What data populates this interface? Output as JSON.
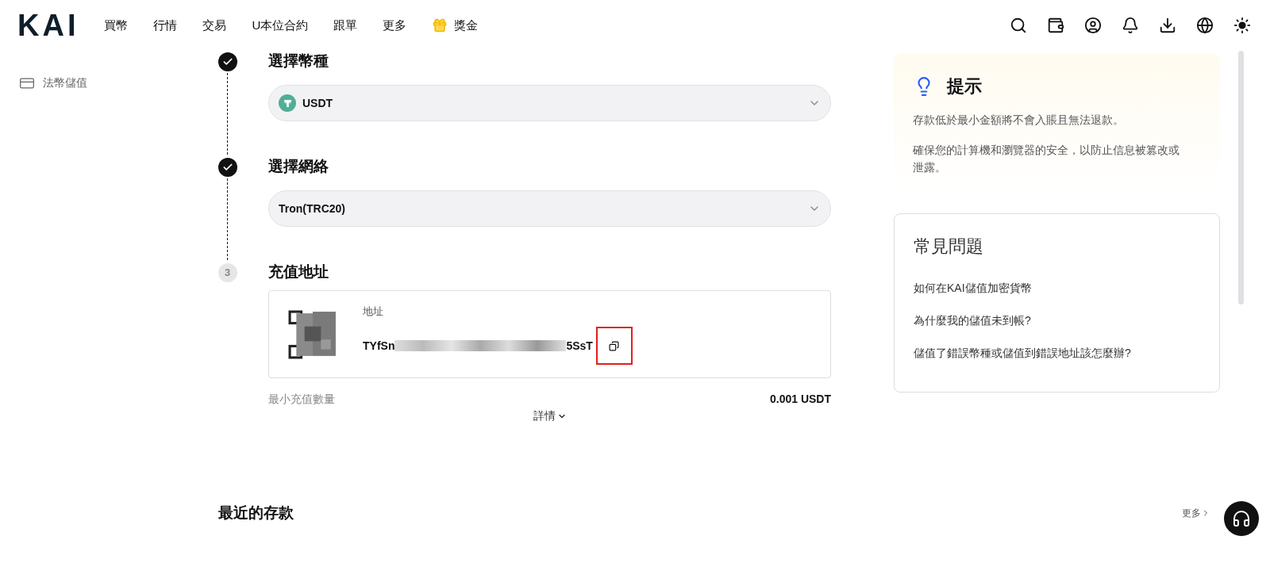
{
  "header": {
    "logo": "KAI",
    "nav": [
      {
        "label": "買幣",
        "kind": "text"
      },
      {
        "label": "行情",
        "kind": "text"
      },
      {
        "label": "交易",
        "kind": "text"
      },
      {
        "label": "U本位合約",
        "kind": "text"
      },
      {
        "label": "跟單",
        "kind": "text"
      },
      {
        "label": "更多",
        "kind": "text"
      },
      {
        "label": "獎金",
        "kind": "gift"
      }
    ]
  },
  "sidebar": {
    "items": [
      {
        "label": "法幣儲值"
      }
    ]
  },
  "steps": [
    {
      "kind": "done",
      "title": "選擇幣種",
      "select": {
        "value": "USDT",
        "kind": "coin"
      }
    },
    {
      "kind": "done",
      "title": "選擇網絡",
      "select": {
        "value": "Tron(TRC20)",
        "kind": "plain"
      }
    },
    {
      "kind": "current",
      "number": "3",
      "title": "充值地址"
    }
  ],
  "address": {
    "label": "地址",
    "start": "TYfSn",
    "end": "5SsT",
    "copy_highlighted": true
  },
  "min_deposit": {
    "label": "最小充值數量",
    "value": "0.001 USDT"
  },
  "details_link": "詳情",
  "recent": {
    "title": "最近的存款",
    "more": "更多"
  },
  "tips": {
    "title": "提示",
    "paragraphs": [
      "存款低於最小金額將不會入賬且無法退款。",
      "確保您的計算機和瀏覽器的安全，以防止信息被篡改或泄露。"
    ]
  },
  "faq": {
    "title": "常見問題",
    "items": [
      "如何在KAI儲值加密貨幣",
      "為什麼我的儲值未到帳?",
      "儲值了錯誤幣種或儲值到錯誤地址該怎麼辦?"
    ]
  }
}
